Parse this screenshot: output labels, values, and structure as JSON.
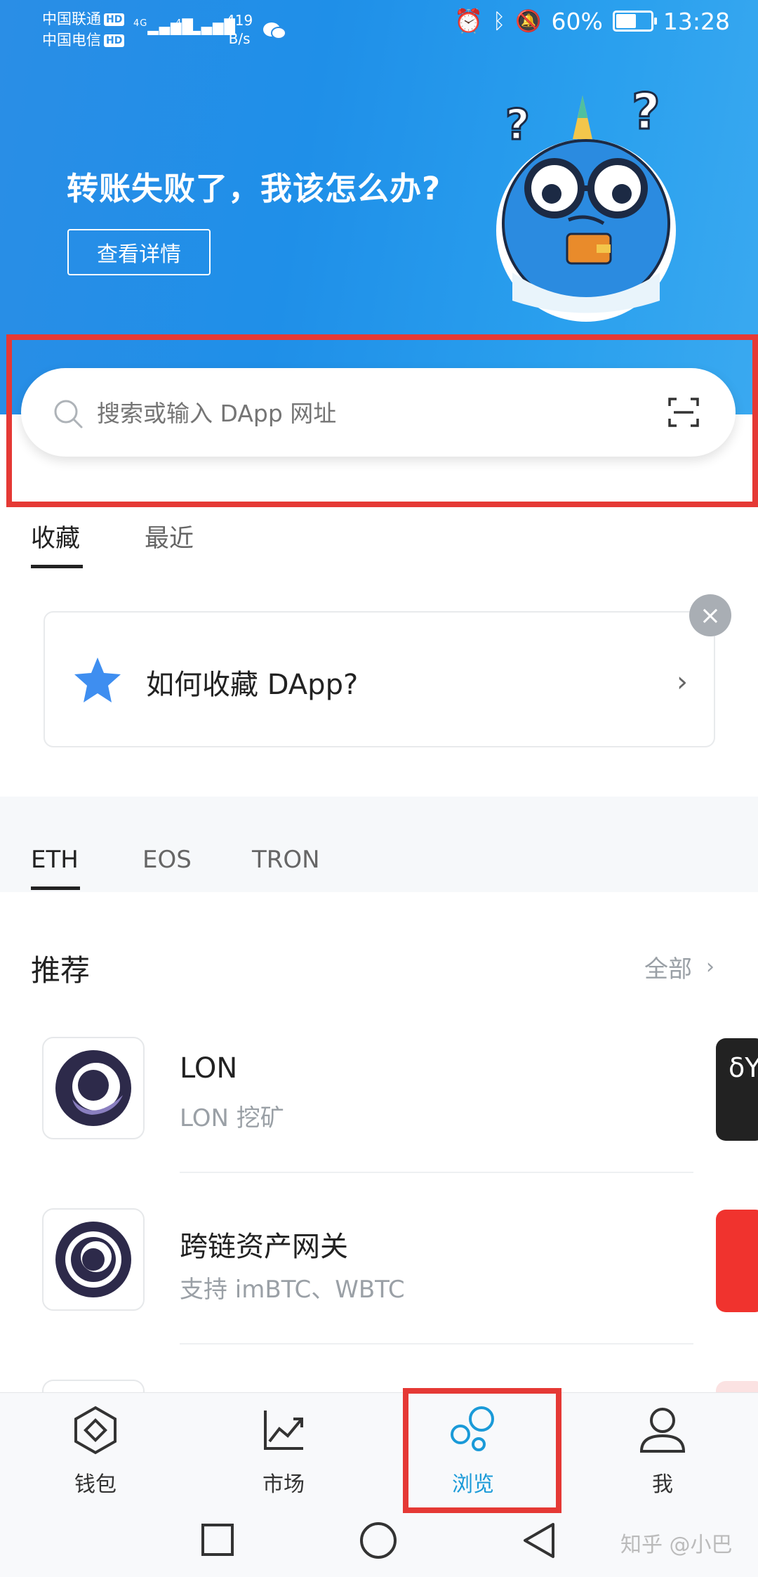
{
  "status_bar": {
    "carrier1": "中国联通",
    "carrier2": "中国电信",
    "hd": "HD",
    "net1": "4G",
    "net2": "4G",
    "speed_value": "419",
    "speed_unit": "B/s",
    "battery": "60%",
    "time": "13:28"
  },
  "banner": {
    "headline": "转账失败了，我该怎么办?",
    "button": "查看详情"
  },
  "search": {
    "placeholder": "搜索或输入 DApp 网址"
  },
  "tabs": {
    "favorites": "收藏",
    "recent": "最近"
  },
  "tip": {
    "text": "如何收藏 DApp?"
  },
  "chains": {
    "eth": "ETH",
    "eos": "EOS",
    "tron": "TRON"
  },
  "recommend": {
    "title": "推荐",
    "all": "全部",
    "apps": [
      {
        "name": "LON",
        "desc": "LON 挖矿"
      },
      {
        "name": "跨链资产网关",
        "desc": "支持 imBTC、WBTC"
      }
    ],
    "peek_text": "δY"
  },
  "nav": {
    "wallet": "钱包",
    "market": "市场",
    "browse": "浏览",
    "me": "我"
  },
  "watermark": "知乎 @小巴",
  "colors": {
    "accent": "#1f8fe8",
    "nav_active": "#1a9ad8",
    "highlight": "#e53935"
  }
}
